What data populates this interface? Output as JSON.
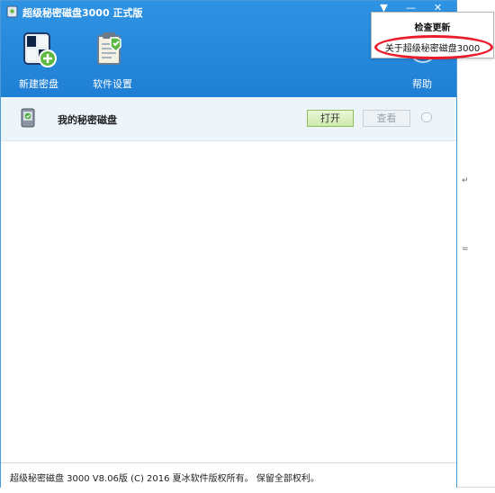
{
  "window": {
    "title": "超级秘密磁盘3000 正式版",
    "icon": "app-disk-icon",
    "controls": [
      "menu-arrow-icon",
      "minimize-icon",
      "close-icon"
    ]
  },
  "toolbar": {
    "new_disk_label": "新建密盘",
    "settings_label": "软件设置",
    "help_label": "帮助",
    "icons": [
      "new-disk-icon",
      "settings-icon",
      "help-icon"
    ]
  },
  "disk_list": [
    {
      "name": "我的秘密磁盘",
      "open_label": "打开",
      "view_label": "查看",
      "icon": "secure-disk-icon"
    }
  ],
  "status": {
    "text": "超级秘密磁盘 3000 V8.06版  (C) 2016 夏冰软件版权所有。 保留全部权利。"
  },
  "menu": {
    "items": [
      "检查更新",
      "关于超级秘密磁盘3000"
    ]
  },
  "colors": {
    "header_blue": "#2f93e3",
    "accent_red": "#ea1d2b",
    "open_green": "#cfe9ae"
  }
}
